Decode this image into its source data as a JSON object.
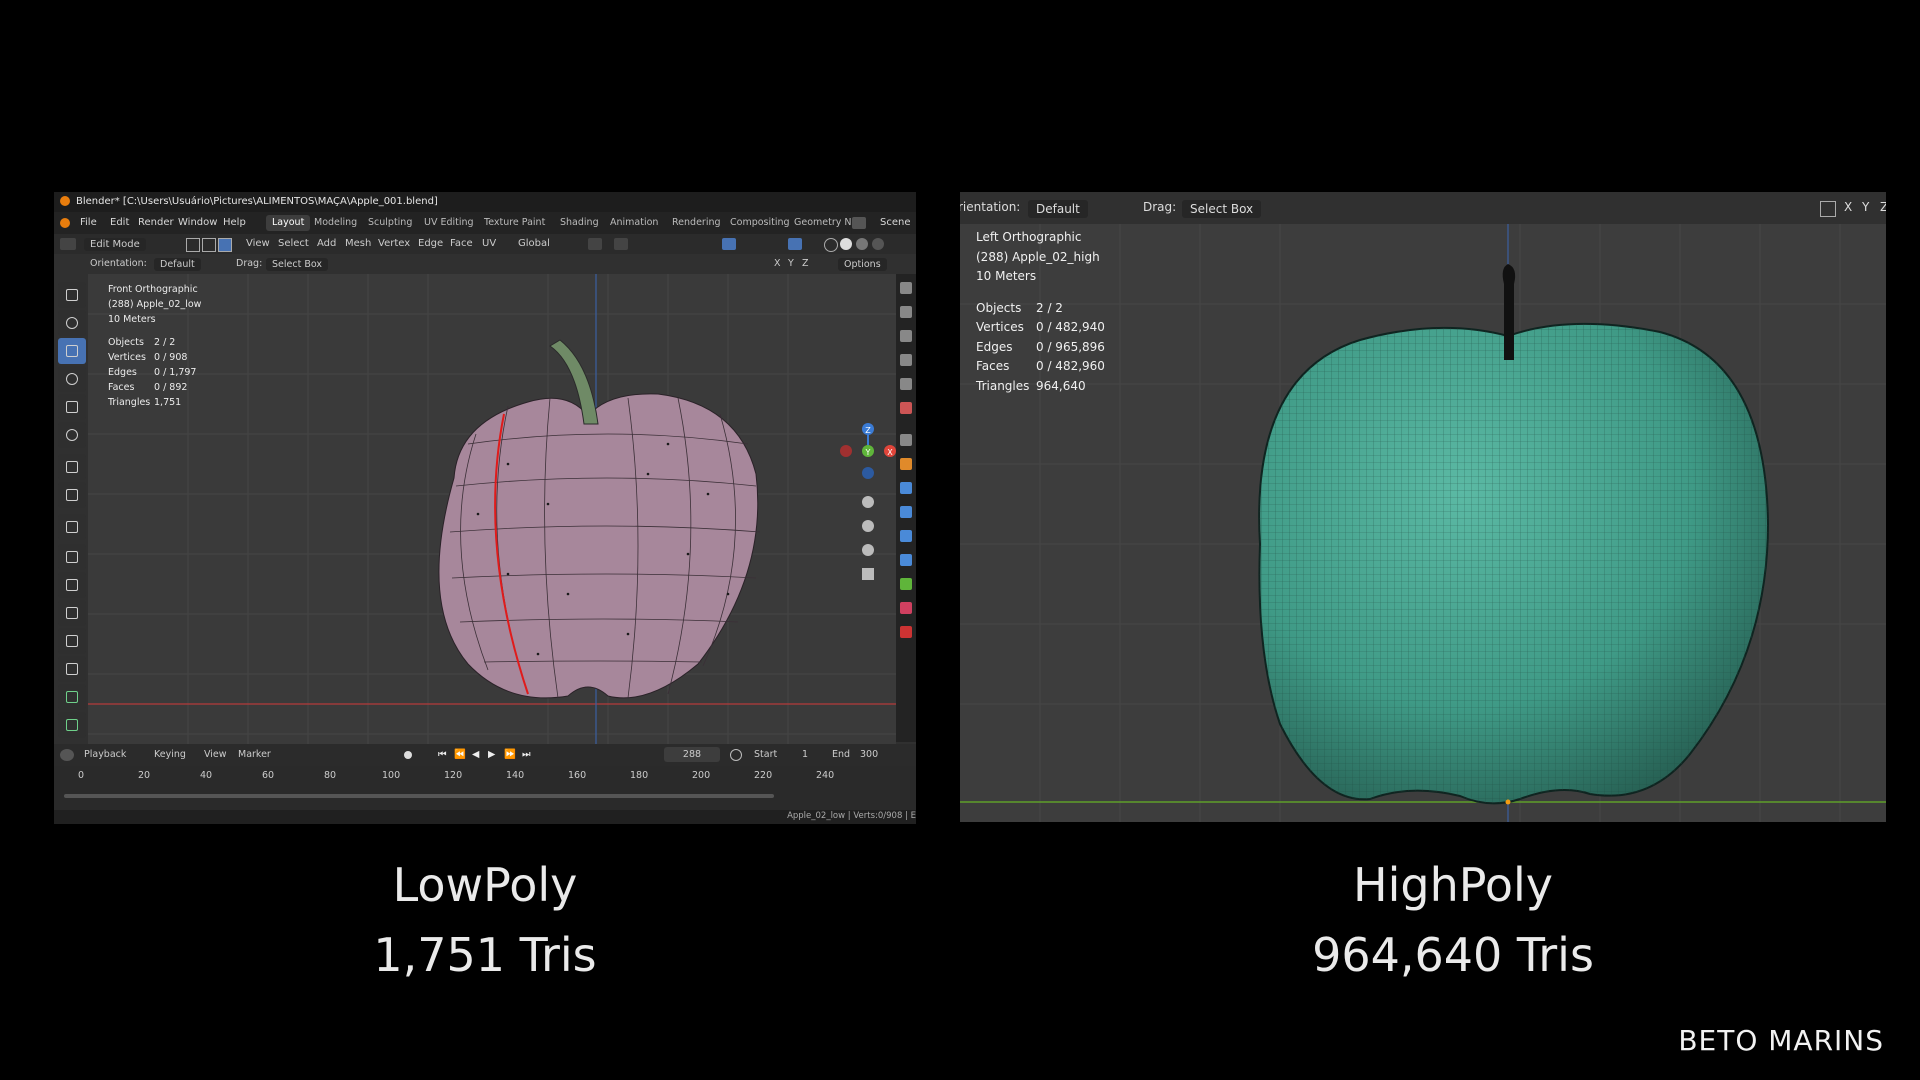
{
  "left": {
    "title": "Blender* [C:\\Users\\Usuário\\Pictures\\ALIMENTOS\\MAÇA\\Apple_001.blend]",
    "menu": [
      "File",
      "Edit",
      "Render",
      "Window",
      "Help"
    ],
    "tabs": [
      "Layout",
      "Modeling",
      "Sculpting",
      "UV Editing",
      "Texture Paint",
      "Shading",
      "Animation",
      "Rendering",
      "Compositing",
      "Geometry Nc"
    ],
    "scene_label": "Scene",
    "mode": "Edit Mode",
    "header_menu": [
      "View",
      "Select",
      "Add",
      "Mesh",
      "Vertex",
      "Edge",
      "Face",
      "UV"
    ],
    "transform": "Global",
    "orientation_label": "Orientation:",
    "orientation_value": "Default",
    "drag_label": "Drag:",
    "drag_value": "Select Box",
    "axis_buttons": [
      "X",
      "Y",
      "Z"
    ],
    "options_label": "Options",
    "overlay": {
      "view_name": "Front Orthographic",
      "object_name": "(288) Apple_02_low",
      "scale": "10 Meters",
      "stats": [
        {
          "label": "Objects",
          "value": "2 / 2"
        },
        {
          "label": "Vertices",
          "value": "0 / 908"
        },
        {
          "label": "Edges",
          "value": "0 / 1,797"
        },
        {
          "label": "Faces",
          "value": "0 / 892"
        },
        {
          "label": "Triangles",
          "value": "1,751"
        }
      ]
    },
    "gizmo": {
      "z": "Z",
      "y": "Y",
      "x": "X"
    },
    "timeline": {
      "menus": [
        "Playback",
        "Keying",
        "View",
        "Marker"
      ],
      "current_frame": "288",
      "start_label": "Start",
      "start_value": "1",
      "end_label": "End",
      "end_value": "300",
      "ticks": [
        "0",
        "20",
        "40",
        "60",
        "80",
        "100",
        "120",
        "140",
        "160",
        "180",
        "200",
        "220",
        "240"
      ]
    },
    "status_text": "Apple_02_low | Verts:0/908 | E",
    "mesh_color": "#a7879b"
  },
  "right": {
    "orientation_label": "rientation:",
    "orientation_value": "Default",
    "drag_label": "Drag:",
    "drag_value": "Select Box",
    "axis_buttons": [
      "X",
      "Y",
      "Z"
    ],
    "overlay": {
      "view_name": "Left Orthographic",
      "object_name": "(288) Apple_02_high",
      "scale": "10 Meters",
      "stats": [
        {
          "label": "Objects",
          "value": "2 / 2"
        },
        {
          "label": "Vertices",
          "value": "0 / 482,940"
        },
        {
          "label": "Edges",
          "value": "0 / 965,896"
        },
        {
          "label": "Faces",
          "value": "0 / 482,960"
        },
        {
          "label": "Triangles",
          "value": "964,640"
        }
      ]
    },
    "mesh_color": "#3f9a86"
  },
  "captions": {
    "left_title": "LowPoly",
    "left_tris": "1,751 Tris",
    "right_title": "HighPoly",
    "right_tris": "964,640 Tris"
  },
  "brand": "BETO MARINS"
}
